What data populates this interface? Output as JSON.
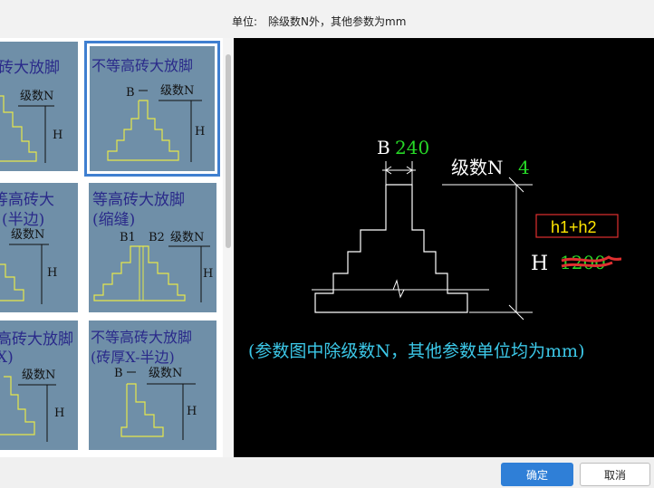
{
  "header": {
    "unit_label": "单位:",
    "unit_note": "除级数N外，其他参数为mm"
  },
  "gallery": {
    "items": [
      {
        "title_1": "砖大放脚",
        "level_label": "级数N",
        "h_label": "H"
      },
      {
        "title_1": "不等高砖大放脚",
        "b_label": "B",
        "level_label": "级数N",
        "h_label": "H"
      },
      {
        "title_1": "等高砖大",
        "title_2": "(半边)",
        "level_label": "级数N",
        "h_label": "H"
      },
      {
        "title_1": "等高砖大放脚",
        "title_2": "(缩缝)",
        "b1_label": "B1",
        "b2_label": "B2",
        "level_label": "级数N",
        "h_label": "H"
      },
      {
        "title_1": "高砖大放脚",
        "title_2": "X)",
        "level_label": "级数N",
        "h_label": "H"
      },
      {
        "title_1": "不等高砖大放脚",
        "title_2": "(砖厚X-半边)",
        "b_label": "B",
        "level_label": "级数N",
        "h_label": "H"
      }
    ]
  },
  "preview": {
    "b_label": "B",
    "b_value": "240",
    "level_label": "级数N",
    "level_value": "4",
    "h_label": "H",
    "h_formula": "h1+h2",
    "h_old_value": "1200",
    "caption": "(参数图中除级数N，其他参数单位均为mm)",
    "colors": {
      "line": "#ffffff",
      "value": "#27d827",
      "caption": "#3cc8e8",
      "formula": "#ffe600",
      "formula_box": "#e03030",
      "strike": "#e03030"
    }
  },
  "footer": {
    "ok_label": "确定",
    "cancel_label": "取消"
  }
}
